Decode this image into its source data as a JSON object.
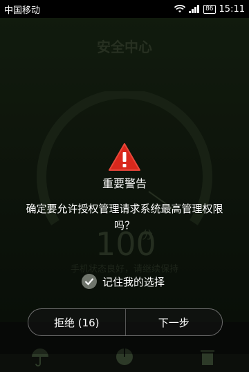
{
  "status_bar": {
    "carrier": "中国移动",
    "battery": "86",
    "time": "15:11"
  },
  "app": {
    "title": "安全中心",
    "score": "100",
    "score_unit": "分",
    "status_text": "手机状态良好，请继续保持"
  },
  "dialog": {
    "title": "重要警告",
    "message": "确定要允许授权管理请求系统最高管理权限吗？",
    "remember_label": "记住我的选择",
    "reject_label": "拒绝 (16)",
    "next_label": "下一步"
  },
  "colors": {
    "warning": "#d9281c",
    "accent_bg": "#1b2a15"
  }
}
